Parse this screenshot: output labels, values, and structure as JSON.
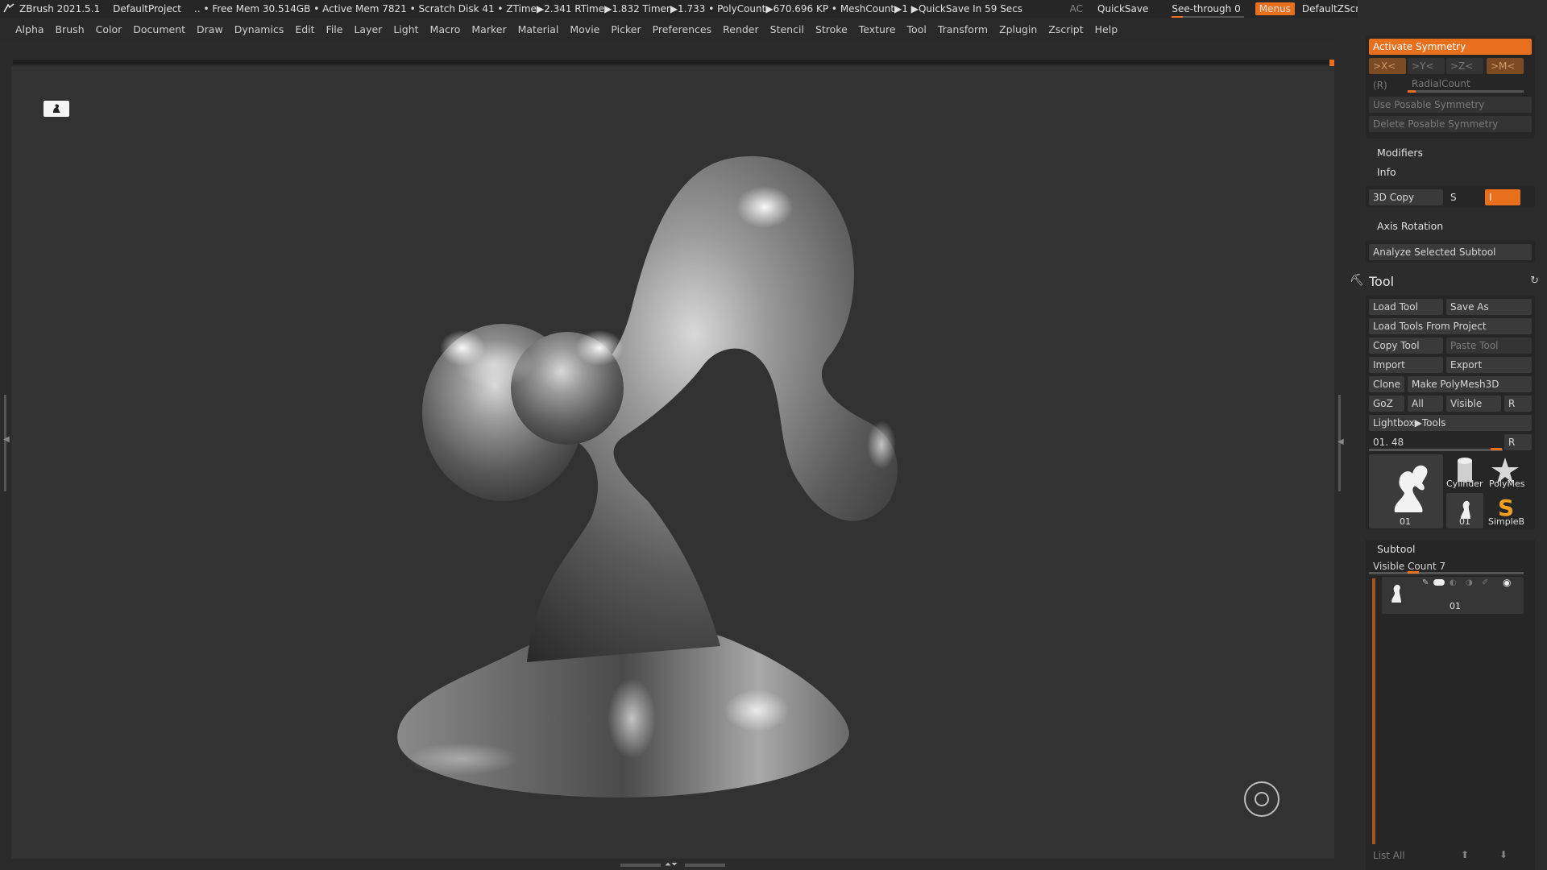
{
  "titlebar": {
    "app": "ZBrush 2021.5.1",
    "project": "DefaultProject",
    "status": ".. • Free Mem 30.514GB • Active Mem 7821 • Scratch Disk 41 • ZTime▶2.341 RTime▶1.832 Timer▶1.733 • PolyCount▶670.696 KP • MeshCount▶1 ▶QuickSave In 59 Secs",
    "ac": "AC",
    "quicksave": "QuickSave",
    "seethrough": "See-through  0",
    "menus": "Menus",
    "zscript": "DefaultZScript"
  },
  "menubar": [
    "Alpha",
    "Brush",
    "Color",
    "Document",
    "Draw",
    "Dynamics",
    "Edit",
    "File",
    "Layer",
    "Light",
    "Macro",
    "Marker",
    "Material",
    "Movie",
    "Picker",
    "Preferences",
    "Render",
    "Stencil",
    "Stroke",
    "Texture",
    "Tool",
    "Transform",
    "Zplugin",
    "Zscript",
    "Help"
  ],
  "symmetry": {
    "activate": "Activate Symmetry",
    "x": ">X<",
    "y": ">Y<",
    "z": ">Z<",
    "m": ">M<",
    "r": "(R)",
    "radial": "RadialCount",
    "use_posable": "Use Posable Symmetry",
    "delete_posable": "Delete Posable Symmetry"
  },
  "panel": {
    "modifiers": "Modifiers",
    "info": "Info",
    "copy3d": "3D Copy",
    "s": "S",
    "i": "I",
    "axis_rotation": "Axis Rotation",
    "analyze": "Analyze Selected Subtool"
  },
  "tool": {
    "title": "Tool",
    "load_tool": "Load Tool",
    "save_as": "Save As",
    "load_from_project": "Load Tools From Project",
    "copy_tool": "Copy Tool",
    "paste_tool": "Paste Tool",
    "import": "Import",
    "export": "Export",
    "clone": "Clone",
    "make_polymesh": "Make PolyMesh3D",
    "goz": "GoZ",
    "all": "All",
    "visible": "Visible",
    "r": "R",
    "lightbox": "Lightbox▶Tools",
    "current": "01. 48",
    "r2": "R",
    "thumbs": [
      "01",
      "Cylinder",
      "PolyMes",
      "01",
      "SimpleB"
    ]
  },
  "subtool": {
    "title": "Subtool",
    "visible_count": "Visible Count 7",
    "item_label": "01",
    "list_all": "List All"
  },
  "colors": {
    "accent": "#e8701c",
    "bg": "#2b2b2b",
    "canvas": "#323232"
  }
}
